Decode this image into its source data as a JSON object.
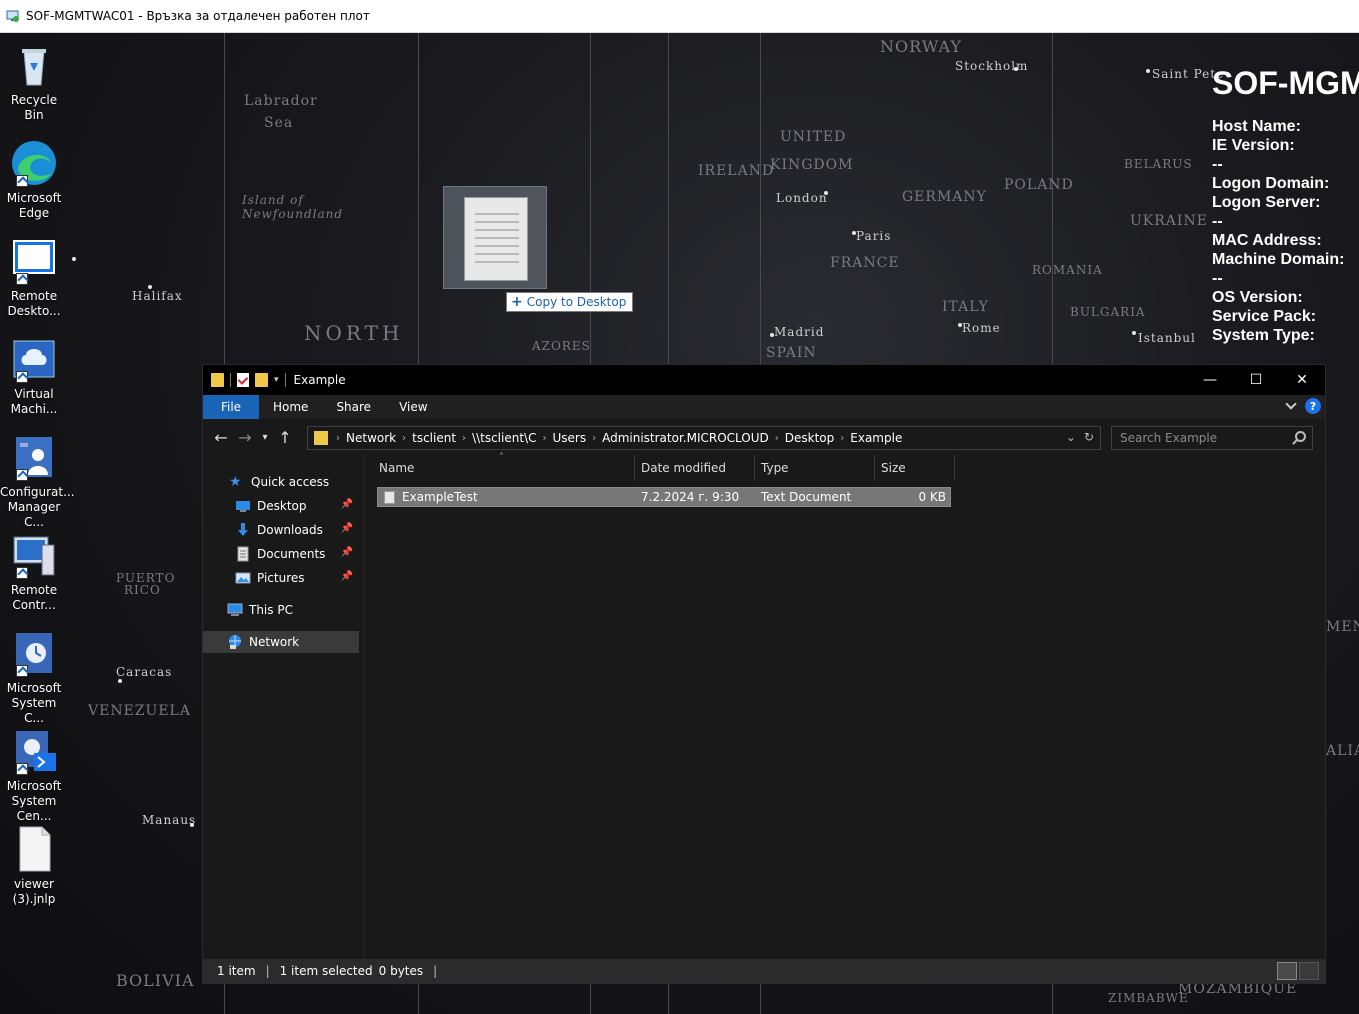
{
  "rdp": {
    "title": "SOF-MGMTWAC01 - Връзка за отдалечен работен плот"
  },
  "desktop_icons": [
    {
      "line1": "Recycle Bin",
      "line2": ""
    },
    {
      "line1": "Microsoft",
      "line2": "Edge"
    },
    {
      "line1": "Remote",
      "line2": "Deskto..."
    },
    {
      "line1": "Virtual",
      "line2": "Machi..."
    },
    {
      "line1": "Configurat...",
      "line2": "Manager C..."
    },
    {
      "line1": "Remote",
      "line2": "Contr..."
    },
    {
      "line1": "Microsoft",
      "line2": "System C..."
    },
    {
      "line1": "Microsoft",
      "line2": "System Cen..."
    },
    {
      "line1": "viewer",
      "line2": "(3).jnlp"
    }
  ],
  "bginfo": {
    "host": "SOF-MGM",
    "rows": [
      "Host Name:",
      "IE Version:",
      "--",
      "Logon Domain:",
      "Logon Server:",
      "--",
      "MAC Address:",
      "Machine Domain:",
      "--",
      "OS Version:",
      "Service Pack:",
      "System Type:"
    ]
  },
  "drag": {
    "tooltip": "Copy to Desktop"
  },
  "explorer": {
    "title": "Example",
    "window_buttons": {
      "minimize": "—",
      "maximize": "☐",
      "close": "✕"
    },
    "ribbon_tabs": [
      "File",
      "Home",
      "Share",
      "View"
    ],
    "breadcrumbs": [
      "Network",
      "tsclient",
      "\\\\tsclient\\C",
      "Users",
      "Administrator.MICROCLOUD",
      "Desktop",
      "Example"
    ],
    "search_placeholder": "Search Example",
    "nav": {
      "quick_access": "Quick access",
      "desktop": "Desktop",
      "downloads": "Downloads",
      "documents": "Documents",
      "pictures": "Pictures",
      "this_pc": "This PC",
      "network": "Network"
    },
    "columns": [
      "Name",
      "Date modified",
      "Type",
      "Size"
    ],
    "files": [
      {
        "name": "ExampleTest",
        "date": "7.2.2024 г. 9:30",
        "type": "Text Document",
        "size": "0 KB"
      }
    ],
    "status": {
      "count": "1 item",
      "selected": "1 item selected",
      "bytes": "0 bytes"
    }
  }
}
